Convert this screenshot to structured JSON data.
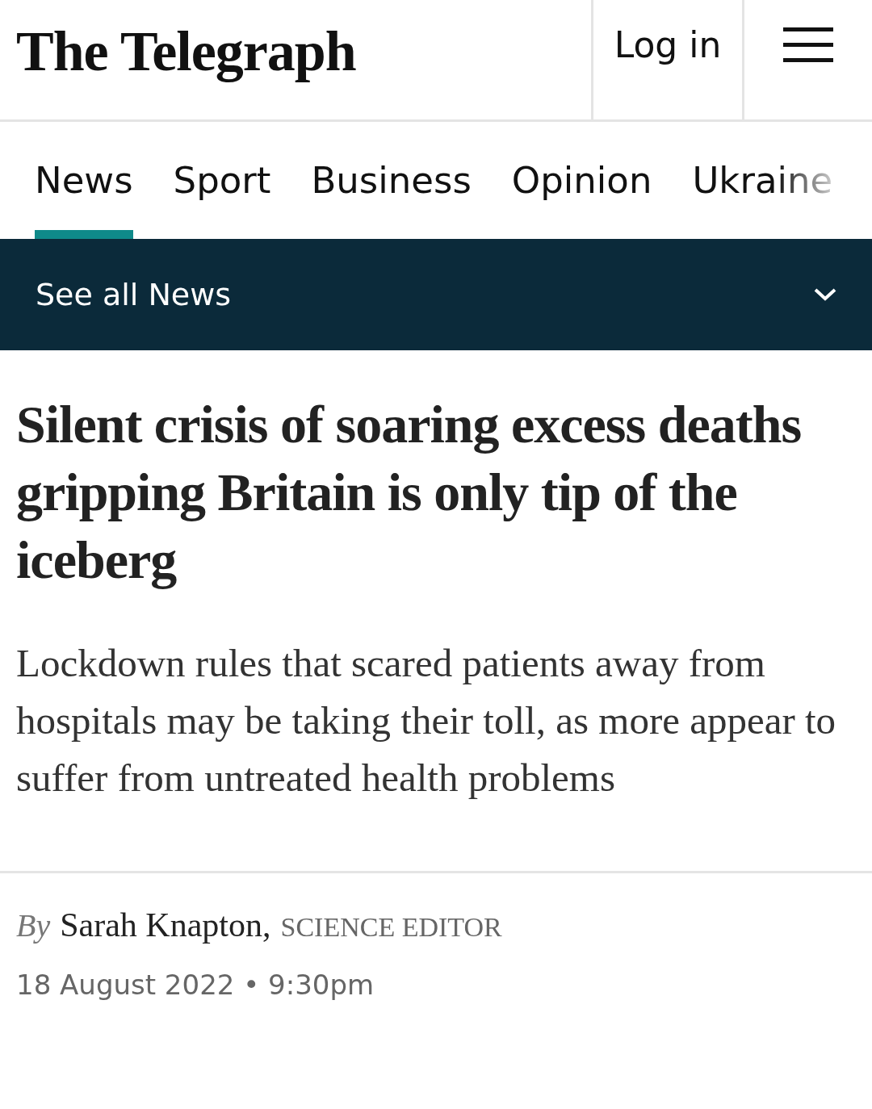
{
  "header": {
    "logo": "The Telegraph",
    "login": "Log in"
  },
  "nav": [
    {
      "label": "News",
      "selected": true
    },
    {
      "label": "Sport",
      "selected": false
    },
    {
      "label": "Business",
      "selected": false
    },
    {
      "label": "Opinion",
      "selected": false
    },
    {
      "label": "Ukraine",
      "selected": false
    }
  ],
  "section_bar": {
    "label": "See all News",
    "expanded": false
  },
  "article": {
    "headline": "Silent crisis of soaring excess deaths gripping Britain is only tip of the iceberg",
    "standfirst": "Lockdown rules that scared patients away from hospitals may be taking their toll, as more appear to suffer from untreated health problems",
    "byline": {
      "prefix": "By",
      "author": "Sarah Knapton,",
      "role": "SCIENCE EDITOR"
    },
    "date": "18 August 2022 • 9:30pm"
  }
}
